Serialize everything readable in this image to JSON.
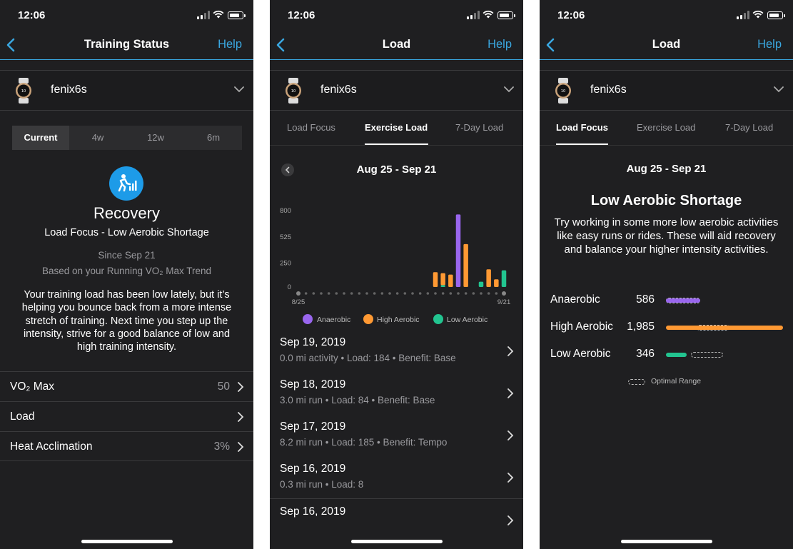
{
  "status_bar": {
    "time": "12:06"
  },
  "device": {
    "name": "fenix6s"
  },
  "help_label": "Help",
  "panel1": {
    "title": "Training Status",
    "periods": [
      "Current",
      "4w",
      "12w",
      "6m"
    ],
    "status": "Recovery",
    "focus": "Load Focus - Low Aerobic Shortage",
    "since": "Since Sep 21",
    "based_on": "Based on your Running VO₂ Max Trend",
    "body": "Your training load has been low lately, but it’s helping you bounce back from a more intense stretch of training. Next time you step up the intensity, strive for a good balance of low and high training intensity.",
    "rows": [
      {
        "label": "VO₂ Max",
        "value": "50"
      },
      {
        "label": "Load",
        "value": ""
      },
      {
        "label": "Heat Acclimation",
        "value": "3%"
      }
    ]
  },
  "panel2": {
    "title": "Load",
    "tabs": [
      "Load Focus",
      "Exercise Load",
      "7-Day Load"
    ],
    "active_tab": "Exercise Load",
    "date_range": "Aug 25 - Sep 21",
    "activities": [
      {
        "date": "Sep 19, 2019",
        "meta": "0.0 mi activity  •  Load: 184  •  Benefit: Base"
      },
      {
        "date": "Sep 18, 2019",
        "meta": "3.0 mi run  •  Load: 84  •  Benefit: Base"
      },
      {
        "date": "Sep 17, 2019",
        "meta": "8.2 mi run  •  Load: 185  •  Benefit: Tempo"
      },
      {
        "date": "Sep 16, 2019",
        "meta": "0.3 mi run  •  Load: 8"
      },
      {
        "date": "Sep 16, 2019",
        "meta": ""
      }
    ]
  },
  "panel3": {
    "title": "Load",
    "tabs": [
      "Load Focus",
      "Exercise Load",
      "7-Day Load"
    ],
    "active_tab": "Load Focus",
    "date_range": "Aug 25 - Sep 21",
    "heading": "Low Aerobic Shortage",
    "body": "Try working in some more low aerobic activities like easy runs or rides. These will aid recovery and balance your higher intensity activities.",
    "focus_rows": [
      {
        "name": "Anaerobic",
        "value": "586",
        "color": "#9966ee"
      },
      {
        "name": "High Aerobic",
        "value": "1,985",
        "color": "#ff9933"
      },
      {
        "name": "Low Aerobic",
        "value": "346",
        "color": "#22c490"
      }
    ],
    "optimal_label": "Optimal Range"
  },
  "chart_data": {
    "type": "bar",
    "stacked": true,
    "y_ticks": [
      "800",
      "525",
      "250",
      "0"
    ],
    "ylim": [
      0,
      800
    ],
    "x_start_label": "8/25",
    "x_end_label": "9/21",
    "num_days": 28,
    "series": [
      {
        "name": "Anaerobic",
        "color": "#9966ee",
        "values": [
          0,
          0,
          0,
          0,
          0,
          0,
          0,
          0,
          0,
          0,
          0,
          0,
          0,
          0,
          0,
          0,
          0,
          0,
          0,
          0,
          0,
          760,
          0,
          0,
          0,
          0,
          0,
          0
        ]
      },
      {
        "name": "High Aerobic",
        "color": "#ff9933",
        "values": [
          0,
          0,
          0,
          0,
          0,
          0,
          0,
          0,
          0,
          0,
          0,
          0,
          0,
          0,
          0,
          0,
          0,
          0,
          155,
          125,
          130,
          0,
          450,
          0,
          0,
          185,
          80,
          0
        ]
      },
      {
        "name": "Low Aerobic",
        "color": "#22c490",
        "values": [
          0,
          0,
          0,
          0,
          0,
          0,
          0,
          0,
          0,
          0,
          0,
          0,
          0,
          0,
          0,
          0,
          0,
          0,
          0,
          20,
          0,
          0,
          0,
          0,
          55,
          0,
          0,
          175
        ]
      }
    ]
  }
}
